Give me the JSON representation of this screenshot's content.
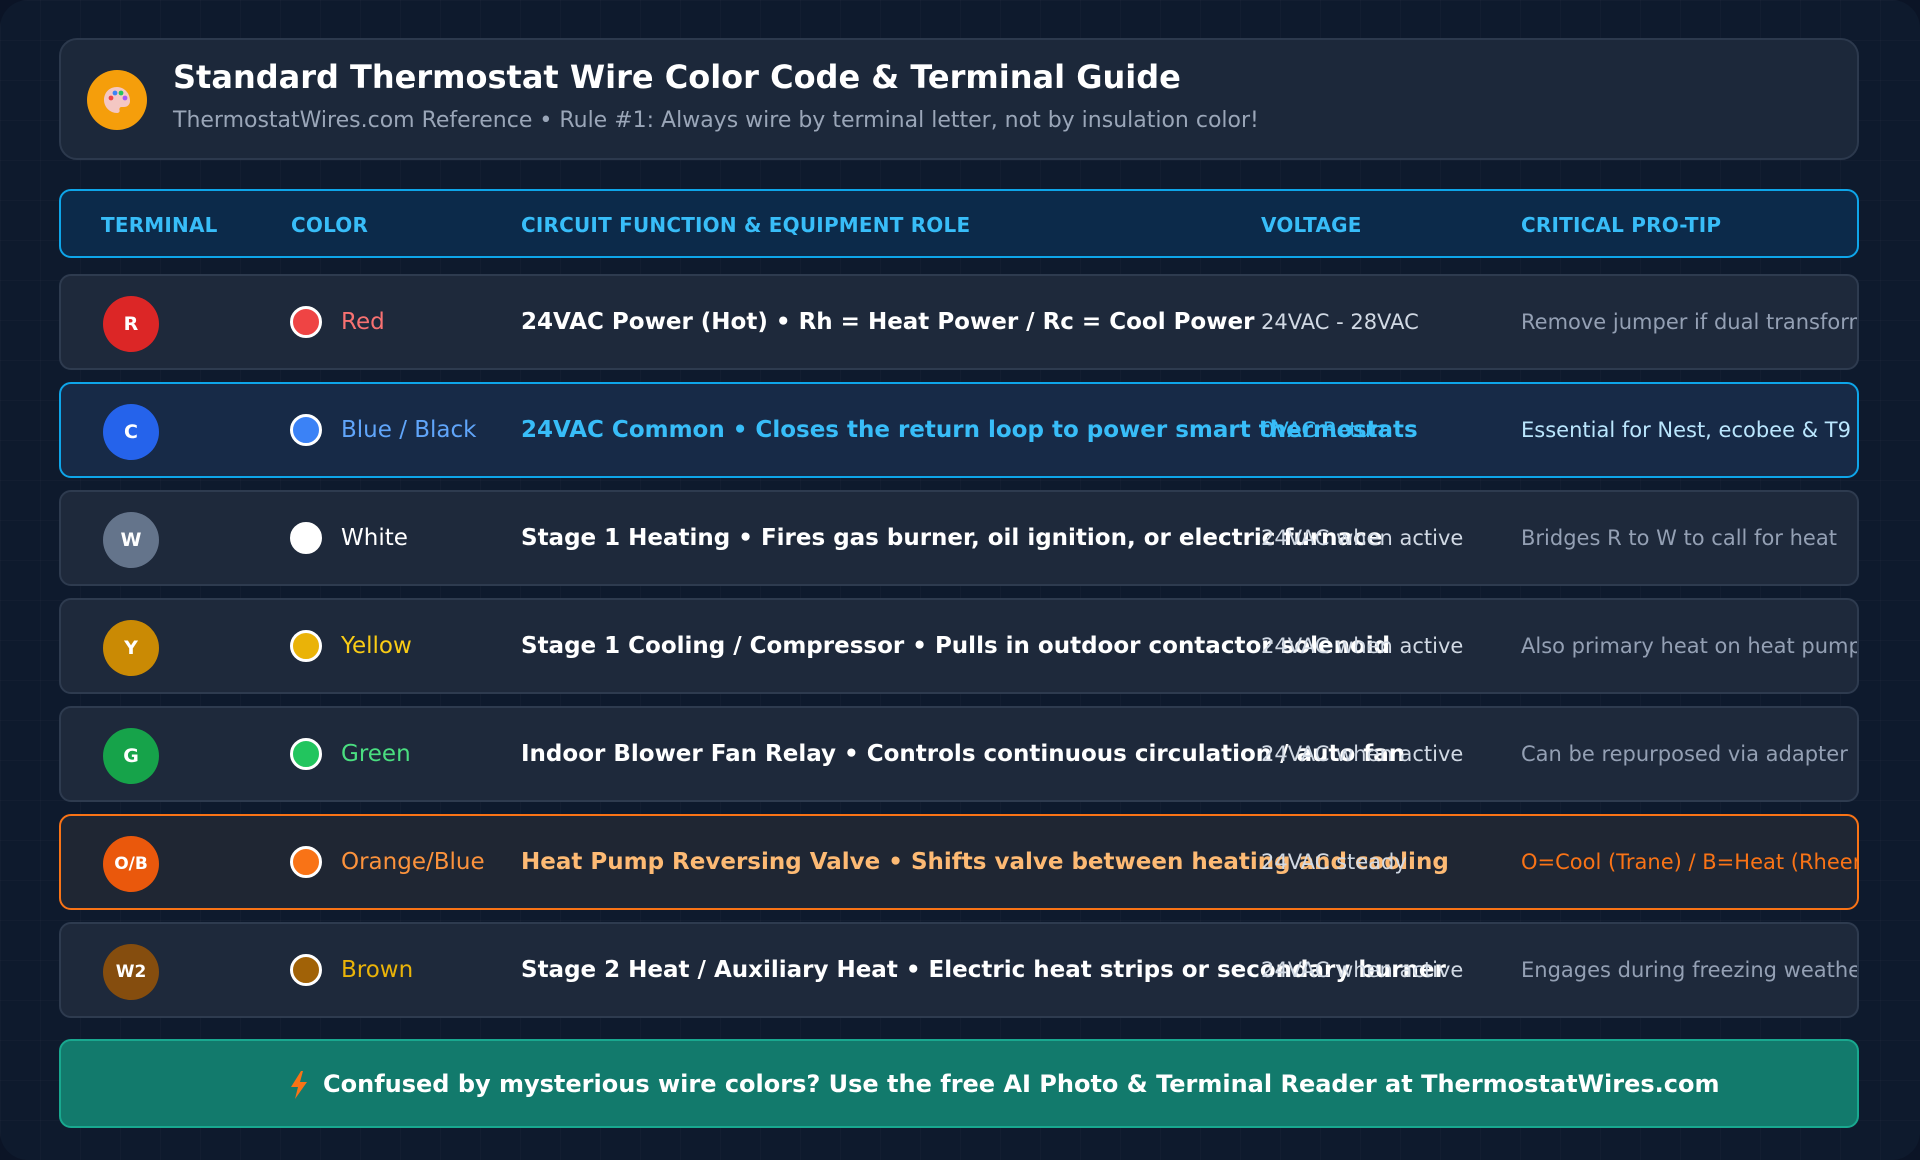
{
  "header": {
    "title": "Standard Thermostat Wire Color Code & Terminal Guide",
    "subtitle": "ThermostatWires.com Reference • Rule #1: Always wire by terminal letter, not by insulation color!",
    "logo_icon": "palette-icon",
    "logo_color": "#f59e0b"
  },
  "table": {
    "headers": [
      "TERMINAL",
      "COLOR",
      "CIRCUIT FUNCTION & EQUIPMENT ROLE",
      "VOLTAGE",
      "CRITICAL PRO-TIP"
    ],
    "rows": [
      {
        "terminal": "R",
        "badge_color": "#dc2626",
        "swatch": "#ef4444",
        "color_name": "Red",
        "name_color": "#f87171",
        "function": "24VAC Power (Hot) • Rh = Heat Power / Rc = Cool Power",
        "voltage": "24VAC - 28VAC",
        "tip": "Remove jumper if dual transformer",
        "highlight": "none"
      },
      {
        "terminal": "C",
        "badge_color": "#2563eb",
        "swatch": "#3b82f6",
        "color_name": "Blue / Black",
        "name_color": "#60a5fa",
        "function": "24VAC Common • Closes the return loop to power smart thermostats",
        "voltage": "0VAC Return",
        "tip": "Essential for Nest, ecobee & T9",
        "highlight": "blue"
      },
      {
        "terminal": "W",
        "badge_color": "#64748b",
        "swatch": "#ffffff",
        "color_name": "White",
        "name_color": "#ffffff",
        "function": "Stage 1 Heating • Fires gas burner, oil ignition, or electric furnace",
        "voltage": "24VAC when active",
        "tip": "Bridges R to W to call for heat",
        "highlight": "none"
      },
      {
        "terminal": "Y",
        "badge_color": "#ca8a04",
        "swatch": "#eab308",
        "color_name": "Yellow",
        "name_color": "#facc15",
        "function": "Stage 1 Cooling / Compressor • Pulls in outdoor contactor solenoid",
        "voltage": "24VAC when active",
        "tip": "Also primary heat on heat pump",
        "highlight": "none"
      },
      {
        "terminal": "G",
        "badge_color": "#16a34a",
        "swatch": "#22c55e",
        "color_name": "Green",
        "name_color": "#4ade80",
        "function": "Indoor Blower Fan Relay • Controls continuous circulation / auto fan",
        "voltage": "24VAC when active",
        "tip": "Can be repurposed via adapter",
        "highlight": "none"
      },
      {
        "terminal": "O/B",
        "badge_color": "#ea580c",
        "swatch": "#f97316",
        "color_name": "Orange/Blue",
        "name_color": "#fb923c",
        "function": "Heat Pump Reversing Valve • Shifts valve between heating and cooling",
        "voltage": "24VAC steady",
        "tip": "O=Cool (Trane) / B=Heat (Rheem)",
        "highlight": "orange"
      },
      {
        "terminal": "W2",
        "badge_color": "#854d0e",
        "swatch": "#a16207",
        "color_name": "Brown",
        "name_color": "#eab308",
        "function": "Stage 2 Heat / Auxiliary Heat • Electric heat strips or secondary burner",
        "voltage": "24VAC when active",
        "tip": "Engages during freezing weather",
        "highlight": "none"
      }
    ]
  },
  "footer": {
    "icon": "lightning-bolt-icon",
    "text": "Confused by mysterious wire colors? Use the free AI Photo & Terminal Reader at ThermostatWires.com"
  }
}
